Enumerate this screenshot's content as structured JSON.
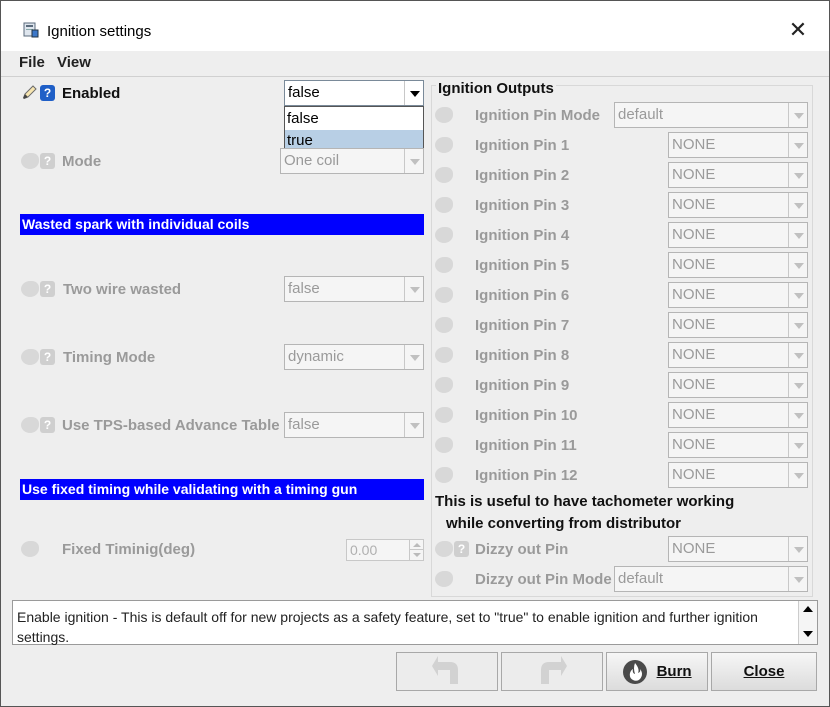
{
  "window": {
    "title": "Ignition settings",
    "close_glyph": "✕"
  },
  "menu": {
    "file": "File",
    "view": "View"
  },
  "left": {
    "enabled": {
      "label": "Enabled",
      "value": "false",
      "options": [
        "false",
        "true"
      ],
      "selected_option": "true"
    },
    "mode": {
      "label": "Mode",
      "value": "One coil"
    },
    "banner1": "Wasted spark with individual coils",
    "two_wire": {
      "label": "Two wire wasted",
      "value": "false"
    },
    "timing_mode": {
      "label": "Timing Mode",
      "value": "dynamic"
    },
    "tps": {
      "label": "Use TPS-based Advance Table",
      "value": "false"
    },
    "banner2": "Use fixed timing while validating with a timing gun",
    "fixed": {
      "label": "Fixed Timinig(deg)",
      "value": "0.00"
    }
  },
  "outputs": {
    "title": "Ignition Outputs",
    "pin_mode": {
      "label": "Ignition Pin Mode",
      "value": "default"
    },
    "pins": [
      {
        "label": "Ignition Pin 1",
        "value": "NONE"
      },
      {
        "label": "Ignition Pin 2",
        "value": "NONE"
      },
      {
        "label": "Ignition Pin 3",
        "value": "NONE"
      },
      {
        "label": "Ignition Pin 4",
        "value": "NONE"
      },
      {
        "label": "Ignition Pin 5",
        "value": "NONE"
      },
      {
        "label": "Ignition Pin 6",
        "value": "NONE"
      },
      {
        "label": "Ignition Pin 7",
        "value": "NONE"
      },
      {
        "label": "Ignition Pin 8",
        "value": "NONE"
      },
      {
        "label": "Ignition Pin 9",
        "value": "NONE"
      },
      {
        "label": "Ignition Pin 10",
        "value": "NONE"
      },
      {
        "label": "Ignition Pin 11",
        "value": "NONE"
      },
      {
        "label": "Ignition Pin 12",
        "value": "NONE"
      }
    ],
    "note_line1": "This is useful to have tachometer working",
    "note_line2": "while converting from distributor",
    "dizzy_pin": {
      "label": "Dizzy out Pin",
      "value": "NONE"
    },
    "dizzy_mode": {
      "label": "Dizzy out Pin Mode",
      "value": "default"
    }
  },
  "help_text": "Enable ignition - This is default off for new projects as a safety feature, set to \"true\" to enable ignition and further ignition settings.",
  "buttons": {
    "burn": "Burn",
    "close": "Close"
  },
  "colors": {
    "banner": "#0000ff",
    "help_icon": "#1f5fc7",
    "selection": "#b8cfe5"
  }
}
